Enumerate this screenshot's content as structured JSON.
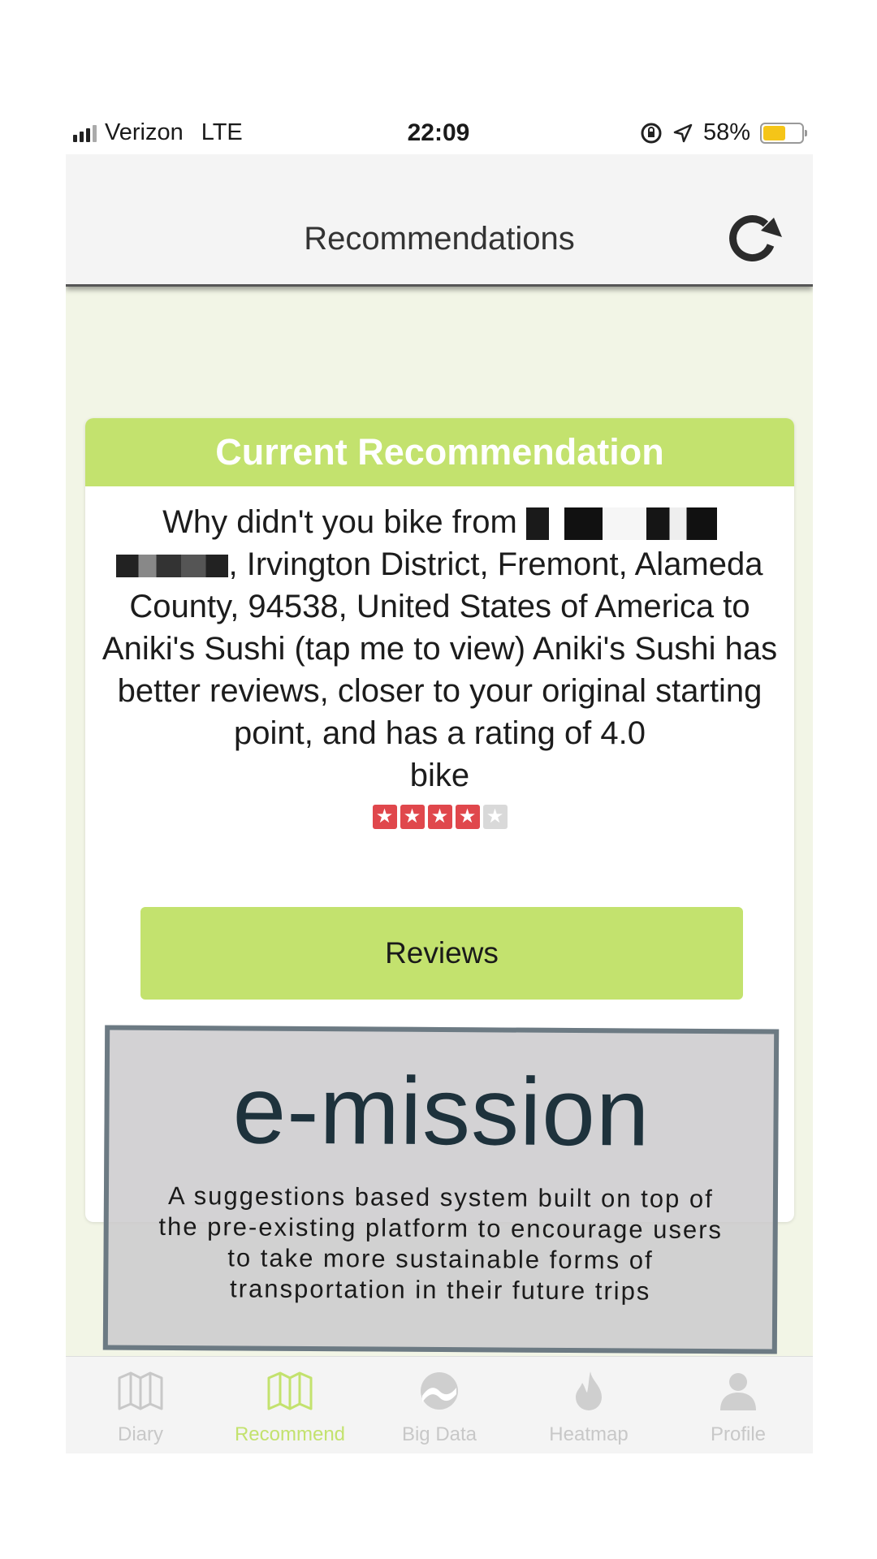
{
  "status_bar": {
    "carrier": "Verizon",
    "network": "LTE",
    "time": "22:09",
    "battery": "58%",
    "battery_level": 0.58,
    "battery_color": "#f5c518"
  },
  "header": {
    "title": "Recommendations",
    "refresh_icon": "refresh-icon"
  },
  "card": {
    "title": "Current Recommendation",
    "line_1": "Why didn't you bike from",
    "line_2": ", Irvington District, Fremont, Alameda County, 94538, United States of America to Aniki's Sushi (tap me to view) Aniki's Sushi has better reviews, closer to your original starting point, and has a rating of 4.0",
    "mode": "bike",
    "rating": 4,
    "rating_max": 5,
    "reviews_label": "Reviews"
  },
  "tabs": [
    {
      "label": "Diary",
      "icon": "map-icon",
      "active": false
    },
    {
      "label": "Recommend",
      "icon": "map-icon",
      "active": true
    },
    {
      "label": "Big Data",
      "icon": "chart-icon",
      "active": false
    },
    {
      "label": "Heatmap",
      "icon": "flame-icon",
      "active": false
    },
    {
      "label": "Profile",
      "icon": "user-icon",
      "active": false
    }
  ],
  "overlay": {
    "title": "e-mission",
    "description": "A suggestions based system built on top of the pre-existing platform to encourage users to take more sustainable forms of transportation in their future trips"
  },
  "colors": {
    "accent": "#c3e26e",
    "background": "#f2f5e6",
    "star": "#e0474c"
  }
}
